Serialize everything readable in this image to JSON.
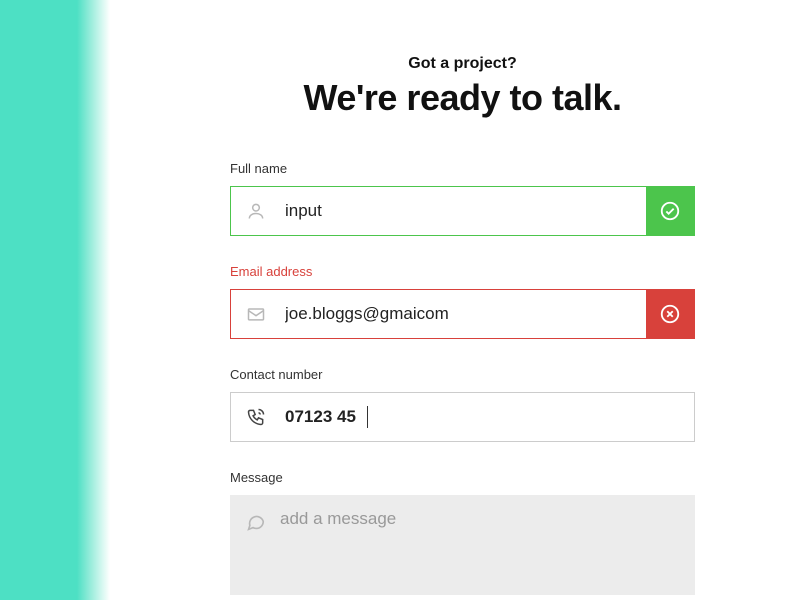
{
  "header": {
    "eyebrow": "Got a project?",
    "headline": "We're ready to talk."
  },
  "fields": {
    "fullname": {
      "label": "Full name",
      "value": "input"
    },
    "email": {
      "label": "Email address",
      "value": "joe.bloggs@gmaicom"
    },
    "phone": {
      "label": "Contact number",
      "value": "07123 45"
    },
    "message": {
      "label": "Message",
      "placeholder": "add a message"
    }
  }
}
